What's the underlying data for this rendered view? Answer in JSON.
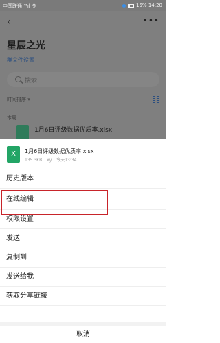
{
  "status_bar": {
    "carrier": "中国联通 ⁴⁶ıl 令",
    "battery": "15%",
    "time": "14:20"
  },
  "background": {
    "title": "星辰之光",
    "subtitle": "群文件设置",
    "search_placeholder": "搜索",
    "sort_label": "时间排序 ▾",
    "section_label": "本周",
    "file_name": "1月6日评级数据优质率.xlsx"
  },
  "sheet": {
    "file_icon_letter": "X",
    "file_name": "1月6日评级数据优质率.xlsx",
    "file_size": "135.3KB",
    "file_owner": "xy",
    "file_time": "今天13:34",
    "menu": [
      {
        "label": "历史版本"
      },
      {
        "label": "在线编辑"
      },
      {
        "label": "权限设置"
      },
      {
        "label": "发送"
      },
      {
        "label": "复制到"
      },
      {
        "label": "发送给我"
      },
      {
        "label": "获取分享链接"
      }
    ],
    "cancel_label": "取消",
    "highlight_color": "#c8242a"
  }
}
